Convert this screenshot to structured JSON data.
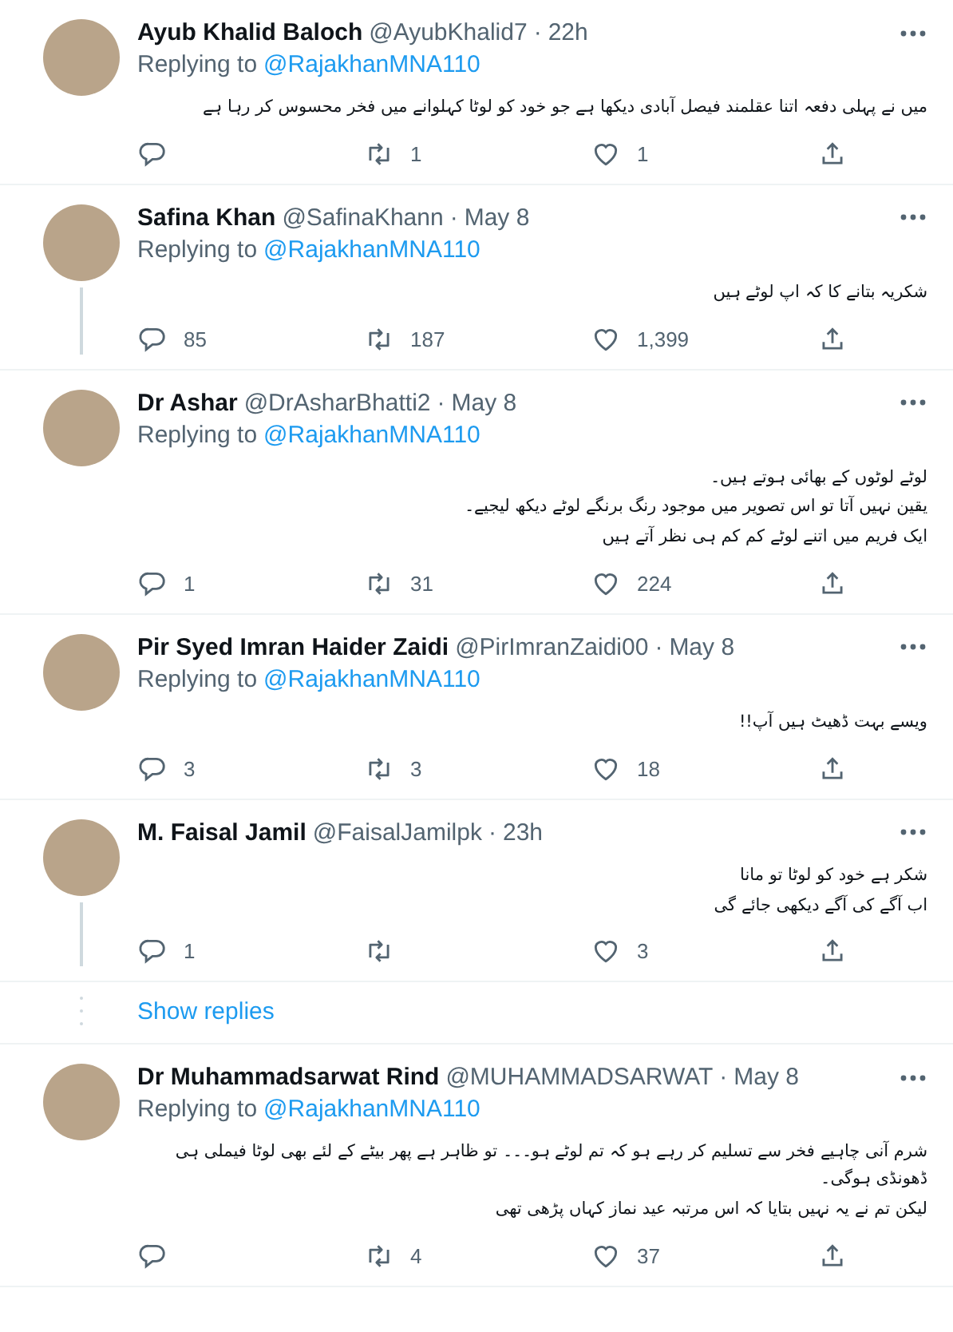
{
  "tweets": [
    {
      "name": "Ayub Khalid Baloch",
      "handle": "@AyubKhalid7",
      "separator": "·",
      "time": "22h",
      "replying_label": "Replying to",
      "replying_to": "@RajakhanMNA110",
      "text_lines": [
        "میں نے پہلی دفعہ اتنا عقلمند فیصل آبادی دیکھا ہے جو خود کو لوٹا کہلوانے میں فخر محسوس کر رہا ہے"
      ],
      "thread_line": false,
      "retweets": "1",
      "likes": "1"
    },
    {
      "name": "Safina Khan",
      "handle": "@SafinaKhann",
      "separator": "·",
      "time": "May 8",
      "replying_label": "Replying to",
      "replying_to": "@RajakhanMNA110",
      "text_lines": [
        "شکریہ بتانے کا کہ اپ لوٹے ہیں"
      ],
      "thread_line": true,
      "replies": "85",
      "retweets": "187",
      "likes": "1,399"
    },
    {
      "name": "Dr Ashar",
      "handle": "@DrAsharBhatti2",
      "separator": "·",
      "time": "May 8",
      "replying_label": "Replying to",
      "replying_to": "@RajakhanMNA110",
      "text_lines": [
        "لوٹے لوٹوں کے بھائی ہوتے ہیں۔",
        "یقین نہیں آتا تو اس تصویر میں موجود رنگ برنگے لوٹے دیکھ لیجیے۔",
        "ایک فریم میں اتنے لوٹے کم کم ہی نظر آتے ہیں"
      ],
      "thread_line": false,
      "replies": "1",
      "retweets": "31",
      "likes": "224"
    },
    {
      "name": "Pir Syed Imran Haider Zaidi",
      "handle": "@PirImranZaidi00",
      "separator": "·",
      "time": "May 8",
      "replying_label": "Replying to",
      "replying_to": "@RajakhanMNA110",
      "text_lines": [
        "ویسے بہت ڈھیٹ ہیں آپ!!"
      ],
      "thread_line": false,
      "replies": "3",
      "retweets": "3",
      "likes": "18"
    },
    {
      "name": "M. Faisal Jamil",
      "handle": "@FaisalJamilpk",
      "separator": "·",
      "time": "23h",
      "text_lines": [
        "شکر ہے خود کو لوٹا تو مانا",
        "اب آگے کی آگے دیکھی جائے گی"
      ],
      "thread_line": true,
      "replies": "1",
      "likes": "3",
      "show_replies": "Show replies"
    },
    {
      "name": "Dr Muhammadsarwat Rind",
      "handle": "@MUHAMMADSARWAT",
      "separator": "·",
      "time": "May 8",
      "replying_label": "Replying to",
      "replying_to": "@RajakhanMNA110",
      "text_lines": [
        "شرم آنی چاہیے فخر سے تسلیم کر رہے ہو کہ تم لوٹے ہو۔۔۔ تو ظاہر ہے پھر بیٹے کے لئے بھی لوٹا فیملی ہی ڈھونڈی ہوگی۔",
        "لیکن تم نے یہ نہیں بتایا کہ اس مرتبہ عید نماز کہاں پڑھی تھی"
      ],
      "thread_line": false,
      "retweets": "4",
      "likes": "37"
    }
  ]
}
